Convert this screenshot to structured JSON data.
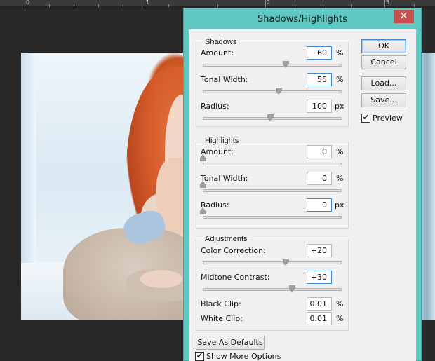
{
  "ruler": {
    "numbers": [
      "0",
      "1",
      "2",
      "3"
    ]
  },
  "dialog": {
    "title": "Shadows/Highlights",
    "close_glyph": "✕",
    "shadows": {
      "legend": "Shadows",
      "amount": {
        "label": "Amount:",
        "value": "60",
        "unit": "%",
        "fraction": 0.6
      },
      "tonal_width": {
        "label": "Tonal Width:",
        "value": "55",
        "unit": "%",
        "fraction": 0.55
      },
      "radius": {
        "label": "Radius:",
        "value": "100",
        "unit": "px",
        "fraction": 0.49
      }
    },
    "highlights": {
      "legend": "Highlights",
      "amount": {
        "label": "Amount:",
        "value": "0",
        "unit": "%",
        "fraction": 0
      },
      "tonal_width": {
        "label": "Tonal Width:",
        "value": "0",
        "unit": "%",
        "fraction": 0
      },
      "radius": {
        "label": "Radius:",
        "value": "0",
        "unit": "px",
        "fraction": 0
      }
    },
    "adjustments": {
      "legend": "Adjustments",
      "color_correction": {
        "label": "Color Correction:",
        "value": "+20",
        "fraction": 0.6
      },
      "midtone_contrast": {
        "label": "Midtone Contrast:",
        "value": "+30",
        "fraction": 0.65
      },
      "black_clip": {
        "label": "Black Clip:",
        "value": "0.01",
        "unit": "%"
      },
      "white_clip": {
        "label": "White Clip:",
        "value": "0.01",
        "unit": "%"
      }
    },
    "buttons": {
      "ok": "OK",
      "cancel": "Cancel",
      "load": "Load...",
      "save": "Save...",
      "save_defaults": "Save As Defaults"
    },
    "preview": {
      "label": "Preview",
      "checked": true,
      "glyph": "✔"
    },
    "show_more": {
      "label": "Show More Options",
      "checked": true,
      "glyph": "✔"
    }
  },
  "colors": {
    "dialog_frame": "#5ec8c3",
    "close_button": "#c7504c",
    "focus_border": "#3c8bd8",
    "workspace": "#282828"
  }
}
